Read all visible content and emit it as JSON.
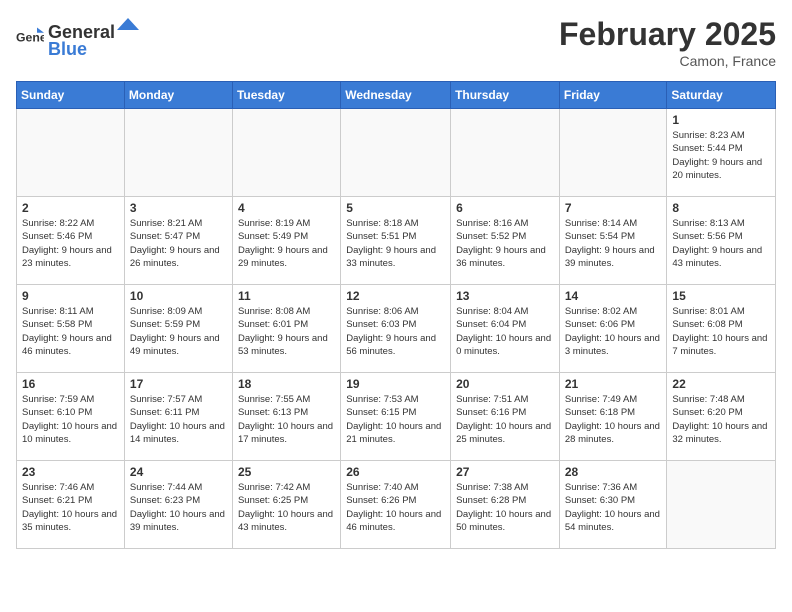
{
  "header": {
    "logo_general": "General",
    "logo_blue": "Blue",
    "title": "February 2025",
    "subtitle": "Camon, France"
  },
  "weekdays": [
    "Sunday",
    "Monday",
    "Tuesday",
    "Wednesday",
    "Thursday",
    "Friday",
    "Saturday"
  ],
  "weeks": [
    [
      {
        "day": "",
        "info": ""
      },
      {
        "day": "",
        "info": ""
      },
      {
        "day": "",
        "info": ""
      },
      {
        "day": "",
        "info": ""
      },
      {
        "day": "",
        "info": ""
      },
      {
        "day": "",
        "info": ""
      },
      {
        "day": "1",
        "info": "Sunrise: 8:23 AM\nSunset: 5:44 PM\nDaylight: 9 hours and 20 minutes."
      }
    ],
    [
      {
        "day": "2",
        "info": "Sunrise: 8:22 AM\nSunset: 5:46 PM\nDaylight: 9 hours and 23 minutes."
      },
      {
        "day": "3",
        "info": "Sunrise: 8:21 AM\nSunset: 5:47 PM\nDaylight: 9 hours and 26 minutes."
      },
      {
        "day": "4",
        "info": "Sunrise: 8:19 AM\nSunset: 5:49 PM\nDaylight: 9 hours and 29 minutes."
      },
      {
        "day": "5",
        "info": "Sunrise: 8:18 AM\nSunset: 5:51 PM\nDaylight: 9 hours and 33 minutes."
      },
      {
        "day": "6",
        "info": "Sunrise: 8:16 AM\nSunset: 5:52 PM\nDaylight: 9 hours and 36 minutes."
      },
      {
        "day": "7",
        "info": "Sunrise: 8:14 AM\nSunset: 5:54 PM\nDaylight: 9 hours and 39 minutes."
      },
      {
        "day": "8",
        "info": "Sunrise: 8:13 AM\nSunset: 5:56 PM\nDaylight: 9 hours and 43 minutes."
      }
    ],
    [
      {
        "day": "9",
        "info": "Sunrise: 8:11 AM\nSunset: 5:58 PM\nDaylight: 9 hours and 46 minutes."
      },
      {
        "day": "10",
        "info": "Sunrise: 8:09 AM\nSunset: 5:59 PM\nDaylight: 9 hours and 49 minutes."
      },
      {
        "day": "11",
        "info": "Sunrise: 8:08 AM\nSunset: 6:01 PM\nDaylight: 9 hours and 53 minutes."
      },
      {
        "day": "12",
        "info": "Sunrise: 8:06 AM\nSunset: 6:03 PM\nDaylight: 9 hours and 56 minutes."
      },
      {
        "day": "13",
        "info": "Sunrise: 8:04 AM\nSunset: 6:04 PM\nDaylight: 10 hours and 0 minutes."
      },
      {
        "day": "14",
        "info": "Sunrise: 8:02 AM\nSunset: 6:06 PM\nDaylight: 10 hours and 3 minutes."
      },
      {
        "day": "15",
        "info": "Sunrise: 8:01 AM\nSunset: 6:08 PM\nDaylight: 10 hours and 7 minutes."
      }
    ],
    [
      {
        "day": "16",
        "info": "Sunrise: 7:59 AM\nSunset: 6:10 PM\nDaylight: 10 hours and 10 minutes."
      },
      {
        "day": "17",
        "info": "Sunrise: 7:57 AM\nSunset: 6:11 PM\nDaylight: 10 hours and 14 minutes."
      },
      {
        "day": "18",
        "info": "Sunrise: 7:55 AM\nSunset: 6:13 PM\nDaylight: 10 hours and 17 minutes."
      },
      {
        "day": "19",
        "info": "Sunrise: 7:53 AM\nSunset: 6:15 PM\nDaylight: 10 hours and 21 minutes."
      },
      {
        "day": "20",
        "info": "Sunrise: 7:51 AM\nSunset: 6:16 PM\nDaylight: 10 hours and 25 minutes."
      },
      {
        "day": "21",
        "info": "Sunrise: 7:49 AM\nSunset: 6:18 PM\nDaylight: 10 hours and 28 minutes."
      },
      {
        "day": "22",
        "info": "Sunrise: 7:48 AM\nSunset: 6:20 PM\nDaylight: 10 hours and 32 minutes."
      }
    ],
    [
      {
        "day": "23",
        "info": "Sunrise: 7:46 AM\nSunset: 6:21 PM\nDaylight: 10 hours and 35 minutes."
      },
      {
        "day": "24",
        "info": "Sunrise: 7:44 AM\nSunset: 6:23 PM\nDaylight: 10 hours and 39 minutes."
      },
      {
        "day": "25",
        "info": "Sunrise: 7:42 AM\nSunset: 6:25 PM\nDaylight: 10 hours and 43 minutes."
      },
      {
        "day": "26",
        "info": "Sunrise: 7:40 AM\nSunset: 6:26 PM\nDaylight: 10 hours and 46 minutes."
      },
      {
        "day": "27",
        "info": "Sunrise: 7:38 AM\nSunset: 6:28 PM\nDaylight: 10 hours and 50 minutes."
      },
      {
        "day": "28",
        "info": "Sunrise: 7:36 AM\nSunset: 6:30 PM\nDaylight: 10 hours and 54 minutes."
      },
      {
        "day": "",
        "info": ""
      }
    ]
  ]
}
